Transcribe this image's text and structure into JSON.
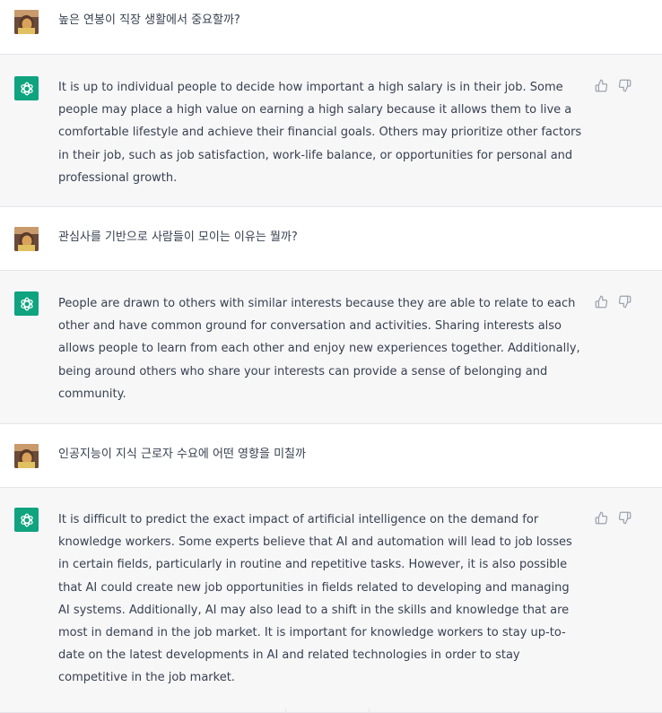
{
  "messages": [
    {
      "role": "user",
      "lines": [
        "높은 연봉이 직장 생활에서 중요할까?"
      ]
    },
    {
      "role": "assistant",
      "lines": [
        "It is up to individual people to decide how important a high salary is in their job. Some",
        "people may place a high value on earning a high salary because it allows them to live a",
        "comfortable lifestyle and achieve their financial goals. Others may prioritize other factors",
        "in their job, such as job satisfaction, work-life balance, or opportunities for personal and",
        "professional growth."
      ]
    },
    {
      "role": "user",
      "lines": [
        "관심사를 기반으로 사람들이 모이는 이유는 뭘까?"
      ]
    },
    {
      "role": "assistant",
      "lines": [
        "People are drawn to others with similar interests because they are able to relate to each",
        "other and have common ground for conversation and activities. Sharing interests also",
        "allows people to learn from each other and enjoy new experiences together. Additionally,",
        "being around others who share your interests can provide a sense of belonging and",
        "community."
      ]
    },
    {
      "role": "user",
      "lines": [
        "인공지능이 지식 근로자 수요에 어떤 영향을 미칠까"
      ]
    },
    {
      "role": "assistant",
      "lines": [
        "It is difficult to predict the exact impact of artificial intelligence on the demand for",
        "knowledge workers. Some experts believe that AI and automation will lead to job losses",
        "in certain fields, particularly in routine and repetitive tasks. However, it is also possible",
        "that AI could create new job opportunities in fields related to developing and managing",
        "AI systems. Additionally, AI may also lead to a shift in the skills and knowledge that are",
        "most in demand in the job market. It is important for knowledge workers to stay up-to-",
        "date on the latest developments in AI and related technologies in order to stay",
        "competitive in the job market."
      ]
    }
  ],
  "icons": {
    "user_avatar": "user-avatar",
    "assistant_avatar": "openai-logo-icon",
    "like": "thumbs-up-icon",
    "dislike": "thumbs-down-icon"
  },
  "colors": {
    "assistant_bg": "#f7f7f8",
    "user_bg": "#ffffff",
    "brand": "#10a37f",
    "text": "#374151"
  }
}
